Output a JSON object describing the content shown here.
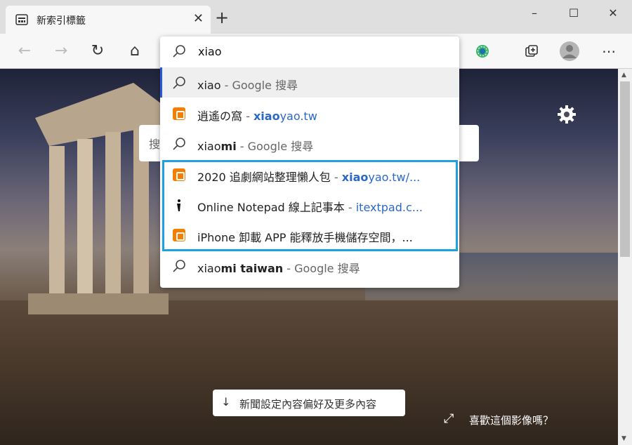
{
  "tab": {
    "title": "新索引標籤",
    "close": "✕"
  },
  "newtab": "+",
  "window": {
    "minimize": "–",
    "maximize": "☐",
    "close": "✕"
  },
  "toolbar": {
    "back": "←",
    "forward": "→",
    "refresh": "↻",
    "home": "⌂",
    "more": "⋯"
  },
  "address": {
    "value": "xiao"
  },
  "suggestions": [
    {
      "type": "search",
      "prefix": "xiao",
      "bold": "",
      "suffix": " - Google 搜尋"
    },
    {
      "type": "site",
      "title": "逍遙の窩",
      "sep": " - ",
      "url_bold": "xiao",
      "url_rest": "yao.tw"
    },
    {
      "type": "search",
      "prefix": "xiao",
      "bold": "mi",
      "suffix": " - Google 搜尋"
    },
    {
      "type": "site",
      "title": "2020 追劇網站整理懶人包",
      "sep": " - ",
      "url_bold": "xiao",
      "url_rest": "yao.tw/..."
    },
    {
      "type": "site",
      "title": "Online Notepad 線上記事本",
      "sep": " - ",
      "url_bold": "",
      "url_rest": "itextpad.c..."
    },
    {
      "type": "site",
      "title": "iPhone 卸載 APP 能釋放手機儲存空間，...",
      "sep": "",
      "url_bold": "",
      "url_rest": ""
    },
    {
      "type": "search",
      "prefix": "xiao",
      "bold": "mi taiwan",
      "suffix": " - Google 搜尋"
    }
  ],
  "page": {
    "search_partial": "搜",
    "news_button": "新聞設定內容偏好及更多內容",
    "like_image": "喜歡這個影像嗎？"
  },
  "colors": {
    "highlight": "#1fa0e0",
    "blogger": "#f57d00",
    "url": "#2b68c8"
  }
}
